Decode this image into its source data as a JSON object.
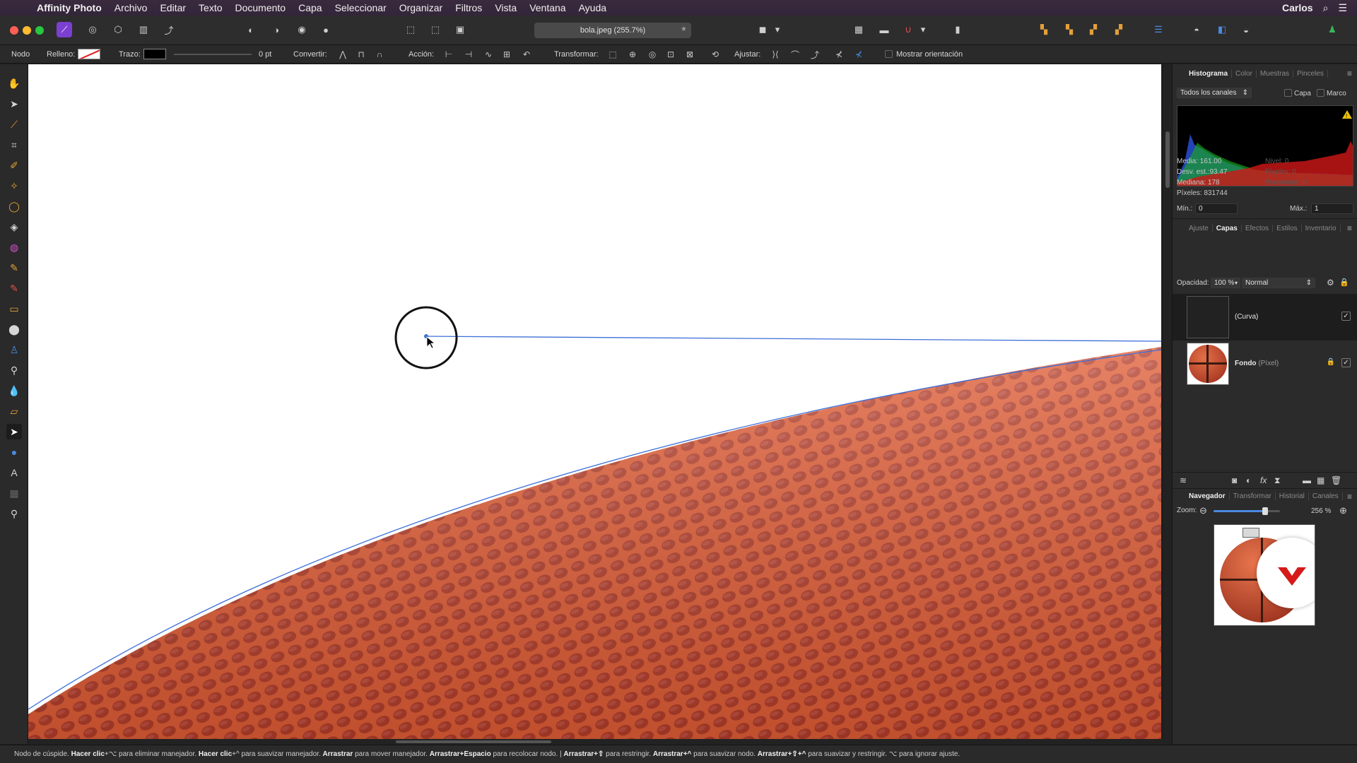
{
  "menubar": {
    "app": "Affinity Photo",
    "items": [
      "Archivo",
      "Editar",
      "Texto",
      "Documento",
      "Capa",
      "Seleccionar",
      "Organizar",
      "Filtros",
      "Vista",
      "Ventana",
      "Ayuda"
    ],
    "user": "Carlos"
  },
  "toolbar": {
    "doc_title": "bola.jpeg (255.7%)"
  },
  "context": {
    "node_label": "Nodo",
    "fill_label": "Relleno:",
    "stroke_label": "Trazo:",
    "stroke_width": "0 pt",
    "convert_label": "Convertir:",
    "action_label": "Acción:",
    "transform_label": "Transformar:",
    "snap_label": "Ajustar:",
    "show_orientation_label": "Mostrar orientación"
  },
  "histogram_panel": {
    "tabs": [
      "Histograma",
      "Color",
      "Muestras",
      "Pinceles"
    ],
    "active_tab": "Histograma",
    "channels": "Todos los canales",
    "layer_chk": "Capa",
    "frame_chk": "Marco",
    "stats_left": [
      "Media: 161.00",
      "Desv. est.:93.47",
      "Mediana: 178",
      "Píxeles: 831744"
    ],
    "stats_right": [
      "Nivel: 0",
      "Píxeles: 0",
      "Porcentaje: 0"
    ],
    "min_label": "Mín.:",
    "min_value": "0",
    "max_label": "Máx.:",
    "max_value": "1",
    "colors": {
      "blue": "#2a4fd6",
      "green": "#19a81a",
      "red": "#d11616"
    }
  },
  "layers_panel": {
    "tabs": [
      "Ajuste",
      "Capas",
      "Efectos",
      "Estilos",
      "Inventario"
    ],
    "active_tab": "Capas",
    "opacity_label": "Opacidad:",
    "opacity_value": "100 %",
    "blend_mode": "Normal",
    "layers": [
      {
        "name": "(Curva)",
        "type": "",
        "visible": "✓"
      },
      {
        "name": "Fondo",
        "type": "(Píxel)",
        "visible": "✓"
      }
    ]
  },
  "navigator_panel": {
    "tabs": [
      "Navegador",
      "Transformar",
      "Historial",
      "Canales"
    ],
    "active_tab": "Navegador",
    "zoom_label": "Zoom:",
    "zoom_value": "256 %",
    "zoom_level": 0.78
  },
  "status_bar": [
    {
      "text": "Nodo de cúspide. ",
      "bold": false
    },
    {
      "text": "Hacer clic",
      "bold": true
    },
    {
      "text": "+⌥ para eliminar manejador. ",
      "bold": false
    },
    {
      "text": "Hacer clic",
      "bold": true
    },
    {
      "text": "+^ para suavizar manejador. ",
      "bold": false
    },
    {
      "text": "Arrastrar",
      "bold": true
    },
    {
      "text": " para mover manejador. ",
      "bold": false
    },
    {
      "text": "Arrastrar+Espacio",
      "bold": true
    },
    {
      "text": " para recolocar nodo. | ",
      "bold": false
    },
    {
      "text": "Arrastrar+⇧",
      "bold": true
    },
    {
      "text": " para restringir. ",
      "bold": false
    },
    {
      "text": "Arrastrar+^",
      "bold": true
    },
    {
      "text": " para suavizar nodo. ",
      "bold": false
    },
    {
      "text": "Arrastrar+⇧+^",
      "bold": true
    },
    {
      "text": " para suavizar y restringir. ⌥ para ignorar ajuste.",
      "bold": false
    }
  ],
  "icons": {
    "traffic": [
      "#ff5f57",
      "#febc2e",
      "#28c840"
    ],
    "accent": "#3d6fd8",
    "ball": "#d9582c"
  }
}
